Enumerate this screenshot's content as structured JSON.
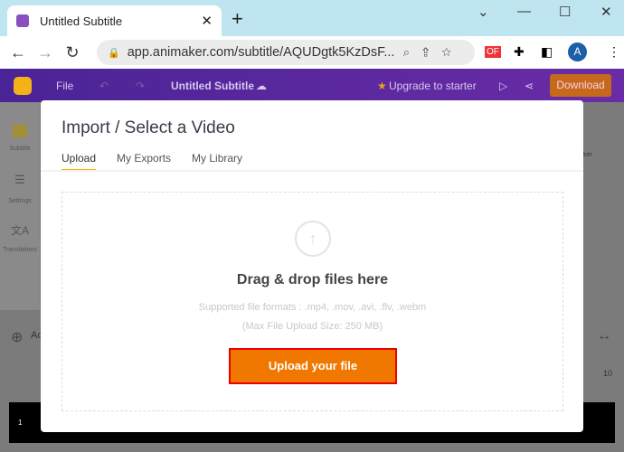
{
  "browser": {
    "tab_title": "Untitled Subtitle",
    "url": "app.animaker.com/subtitle/AQUDgtk5KzDsF...",
    "profile_initial": "A",
    "ext_label": "OF"
  },
  "app": {
    "file_menu": "File",
    "project_title": "Untitled Subtitle",
    "upgrade": "Upgrade to starter",
    "download": "Download"
  },
  "sidebar": {
    "items": [
      {
        "label": "Subtitle"
      },
      {
        "label": "Settings"
      },
      {
        "label": "Translations"
      }
    ]
  },
  "background": {
    "add_label": "Ac",
    "timeline_end": "10",
    "track_num": "1",
    "side_label": "ker"
  },
  "modal": {
    "title": "Import / Select a Video",
    "tabs": [
      {
        "label": "Upload",
        "active": true
      },
      {
        "label": "My Exports"
      },
      {
        "label": "My Library"
      }
    ],
    "drop_title": "Drag & drop files here",
    "formats": "Supported file formats : .mp4, .mov, .avi, .flv, .webm",
    "max_size": "(Max File Upload Size: 250 MB)",
    "upload_button": "Upload your file"
  }
}
